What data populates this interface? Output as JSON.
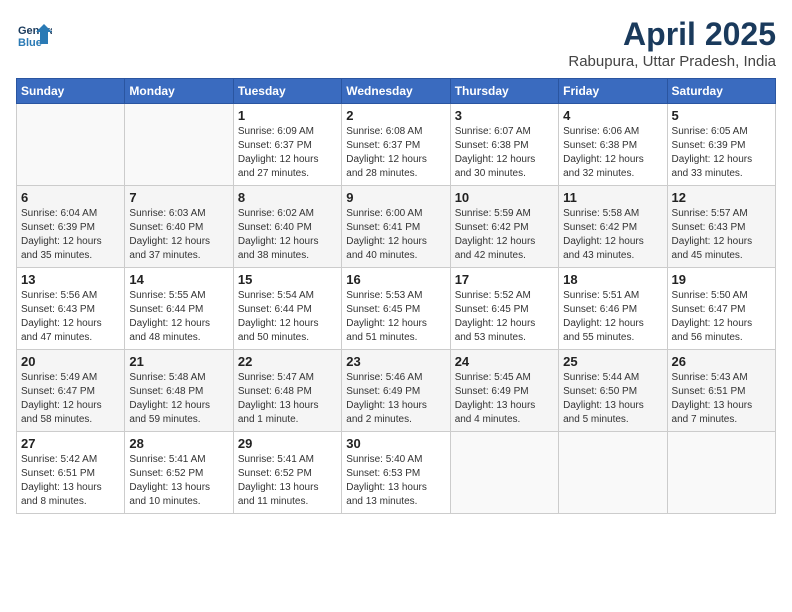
{
  "header": {
    "logo_line1": "General",
    "logo_line2": "Blue",
    "title": "April 2025",
    "subtitle": "Rabupura, Uttar Pradesh, India"
  },
  "days_of_week": [
    "Sunday",
    "Monday",
    "Tuesday",
    "Wednesday",
    "Thursday",
    "Friday",
    "Saturday"
  ],
  "weeks": [
    [
      {
        "day": "",
        "detail": ""
      },
      {
        "day": "",
        "detail": ""
      },
      {
        "day": "1",
        "detail": "Sunrise: 6:09 AM\nSunset: 6:37 PM\nDaylight: 12 hours\nand 27 minutes."
      },
      {
        "day": "2",
        "detail": "Sunrise: 6:08 AM\nSunset: 6:37 PM\nDaylight: 12 hours\nand 28 minutes."
      },
      {
        "day": "3",
        "detail": "Sunrise: 6:07 AM\nSunset: 6:38 PM\nDaylight: 12 hours\nand 30 minutes."
      },
      {
        "day": "4",
        "detail": "Sunrise: 6:06 AM\nSunset: 6:38 PM\nDaylight: 12 hours\nand 32 minutes."
      },
      {
        "day": "5",
        "detail": "Sunrise: 6:05 AM\nSunset: 6:39 PM\nDaylight: 12 hours\nand 33 minutes."
      }
    ],
    [
      {
        "day": "6",
        "detail": "Sunrise: 6:04 AM\nSunset: 6:39 PM\nDaylight: 12 hours\nand 35 minutes."
      },
      {
        "day": "7",
        "detail": "Sunrise: 6:03 AM\nSunset: 6:40 PM\nDaylight: 12 hours\nand 37 minutes."
      },
      {
        "day": "8",
        "detail": "Sunrise: 6:02 AM\nSunset: 6:40 PM\nDaylight: 12 hours\nand 38 minutes."
      },
      {
        "day": "9",
        "detail": "Sunrise: 6:00 AM\nSunset: 6:41 PM\nDaylight: 12 hours\nand 40 minutes."
      },
      {
        "day": "10",
        "detail": "Sunrise: 5:59 AM\nSunset: 6:42 PM\nDaylight: 12 hours\nand 42 minutes."
      },
      {
        "day": "11",
        "detail": "Sunrise: 5:58 AM\nSunset: 6:42 PM\nDaylight: 12 hours\nand 43 minutes."
      },
      {
        "day": "12",
        "detail": "Sunrise: 5:57 AM\nSunset: 6:43 PM\nDaylight: 12 hours\nand 45 minutes."
      }
    ],
    [
      {
        "day": "13",
        "detail": "Sunrise: 5:56 AM\nSunset: 6:43 PM\nDaylight: 12 hours\nand 47 minutes."
      },
      {
        "day": "14",
        "detail": "Sunrise: 5:55 AM\nSunset: 6:44 PM\nDaylight: 12 hours\nand 48 minutes."
      },
      {
        "day": "15",
        "detail": "Sunrise: 5:54 AM\nSunset: 6:44 PM\nDaylight: 12 hours\nand 50 minutes."
      },
      {
        "day": "16",
        "detail": "Sunrise: 5:53 AM\nSunset: 6:45 PM\nDaylight: 12 hours\nand 51 minutes."
      },
      {
        "day": "17",
        "detail": "Sunrise: 5:52 AM\nSunset: 6:45 PM\nDaylight: 12 hours\nand 53 minutes."
      },
      {
        "day": "18",
        "detail": "Sunrise: 5:51 AM\nSunset: 6:46 PM\nDaylight: 12 hours\nand 55 minutes."
      },
      {
        "day": "19",
        "detail": "Sunrise: 5:50 AM\nSunset: 6:47 PM\nDaylight: 12 hours\nand 56 minutes."
      }
    ],
    [
      {
        "day": "20",
        "detail": "Sunrise: 5:49 AM\nSunset: 6:47 PM\nDaylight: 12 hours\nand 58 minutes."
      },
      {
        "day": "21",
        "detail": "Sunrise: 5:48 AM\nSunset: 6:48 PM\nDaylight: 12 hours\nand 59 minutes."
      },
      {
        "day": "22",
        "detail": "Sunrise: 5:47 AM\nSunset: 6:48 PM\nDaylight: 13 hours\nand 1 minute."
      },
      {
        "day": "23",
        "detail": "Sunrise: 5:46 AM\nSunset: 6:49 PM\nDaylight: 13 hours\nand 2 minutes."
      },
      {
        "day": "24",
        "detail": "Sunrise: 5:45 AM\nSunset: 6:49 PM\nDaylight: 13 hours\nand 4 minutes."
      },
      {
        "day": "25",
        "detail": "Sunrise: 5:44 AM\nSunset: 6:50 PM\nDaylight: 13 hours\nand 5 minutes."
      },
      {
        "day": "26",
        "detail": "Sunrise: 5:43 AM\nSunset: 6:51 PM\nDaylight: 13 hours\nand 7 minutes."
      }
    ],
    [
      {
        "day": "27",
        "detail": "Sunrise: 5:42 AM\nSunset: 6:51 PM\nDaylight: 13 hours\nand 8 minutes."
      },
      {
        "day": "28",
        "detail": "Sunrise: 5:41 AM\nSunset: 6:52 PM\nDaylight: 13 hours\nand 10 minutes."
      },
      {
        "day": "29",
        "detail": "Sunrise: 5:41 AM\nSunset: 6:52 PM\nDaylight: 13 hours\nand 11 minutes."
      },
      {
        "day": "30",
        "detail": "Sunrise: 5:40 AM\nSunset: 6:53 PM\nDaylight: 13 hours\nand 13 minutes."
      },
      {
        "day": "",
        "detail": ""
      },
      {
        "day": "",
        "detail": ""
      },
      {
        "day": "",
        "detail": ""
      }
    ]
  ]
}
